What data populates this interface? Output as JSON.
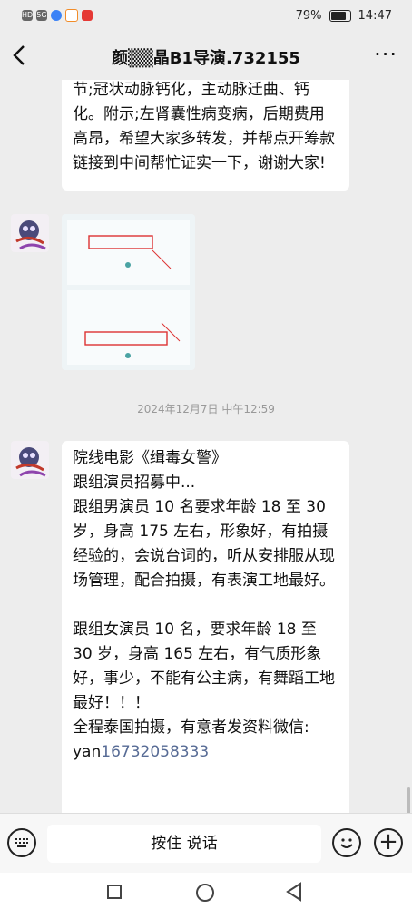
{
  "status": {
    "left_badges": [
      "HD",
      "5G"
    ],
    "battery_percent": "79%",
    "time": "14:47"
  },
  "header": {
    "title": "颜▒▒晶B1导演.732155"
  },
  "messages": {
    "first_text": "节;冠状动脉钙化，主动脉迁曲、钙化。附示;左肾囊性病变病，后期费用高昂，希望大家多转发，并帮点开筹款链接到中间帮忙证实一下，谢谢大家!",
    "timestamp": "2024年12月7日 中午12:59",
    "second_lines": [
      "院线电影《缉毒女警》",
      "跟组演员招募中...",
      "跟组男演员 10 名要求年龄 18 至 30 岁，身高 175 左右，形象好，有拍摄经验的，会说台词的，听从安排服从现场管理，配合拍摄，有表演工地最好。",
      "跟组女演员 10 名，要求年龄 18 至 30 岁，身高 165 左右，有气质形象好，事少，不能有公主病，有舞蹈工地最好！！！",
      "全程泰国拍摄，有意者发资料微信:"
    ],
    "wechat_prefix": "yan",
    "wechat_number": "16732058333"
  },
  "input": {
    "hold_to_talk": "按住 说话"
  }
}
